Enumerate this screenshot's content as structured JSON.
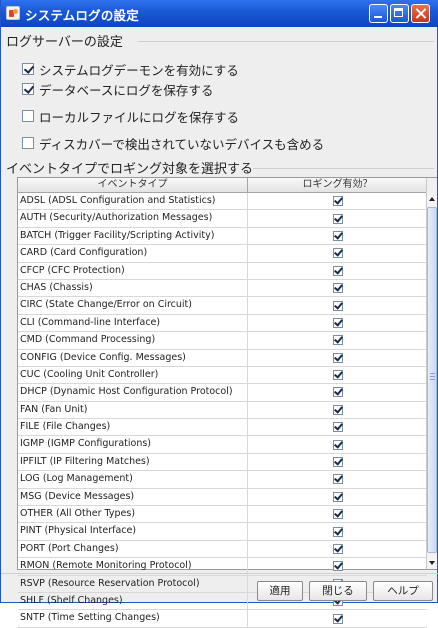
{
  "window": {
    "title": "システムログの設定"
  },
  "log_server_section": {
    "title": "ログサーバーの設定",
    "options": [
      {
        "label": "システムログデーモンを有効にする",
        "checked": true
      },
      {
        "label": "データベースにログを保存する",
        "checked": true
      },
      {
        "label": "ローカルファイルにログを保存する",
        "checked": false
      },
      {
        "label": "ディスカバーで検出されていないデバイスも含める",
        "checked": false
      }
    ]
  },
  "event_section": {
    "title": "イベントタイプでロギング対象を選択する",
    "columns": [
      "イベントタイプ",
      "ロギング有効？"
    ],
    "rows": [
      {
        "type": "ADSL (ADSL Configuration and Statistics)",
        "enabled": true
      },
      {
        "type": "AUTH (Security/Authorization Messages)",
        "enabled": true
      },
      {
        "type": "BATCH (Trigger Facility/Scripting Activity)",
        "enabled": true
      },
      {
        "type": "CARD (Card Configuration)",
        "enabled": true
      },
      {
        "type": "CFCP (CFC Protection)",
        "enabled": true
      },
      {
        "type": "CHAS (Chassis)",
        "enabled": true
      },
      {
        "type": "CIRC (State Change/Error on Circuit)",
        "enabled": true
      },
      {
        "type": "CLI (Command-line Interface)",
        "enabled": true
      },
      {
        "type": "CMD (Command Processing)",
        "enabled": true
      },
      {
        "type": "CONFIG (Device Config. Messages)",
        "enabled": true
      },
      {
        "type": "CUC (Cooling Unit Controller)",
        "enabled": true
      },
      {
        "type": "DHCP (Dynamic Host Configuration Protocol)",
        "enabled": true
      },
      {
        "type": "FAN (Fan Unit)",
        "enabled": true
      },
      {
        "type": "FILE (File Changes)",
        "enabled": true
      },
      {
        "type": "IGMP (IGMP Configurations)",
        "enabled": true
      },
      {
        "type": "IPFILT (IP Filtering Matches)",
        "enabled": true
      },
      {
        "type": "LOG (Log Management)",
        "enabled": true
      },
      {
        "type": "MSG (Device Messages)",
        "enabled": true
      },
      {
        "type": "OTHER (All Other Types)",
        "enabled": true
      },
      {
        "type": "PINT (Physical Interface)",
        "enabled": true
      },
      {
        "type": "PORT (Port Changes)",
        "enabled": true
      },
      {
        "type": "RMON (Remote Monitoring Protocol)",
        "enabled": true
      },
      {
        "type": "RSVP (Resource Reservation Protocol)",
        "enabled": true
      },
      {
        "type": "SHLF (Shelf Changes)",
        "enabled": true
      },
      {
        "type": "SNTP (Time Setting Changes)",
        "enabled": true
      }
    ]
  },
  "buttons": {
    "apply": "適用",
    "close": "閉じる",
    "help": "ヘルプ"
  },
  "colors": {
    "titlebar": "#1b5ad6",
    "close_button": "#c4381b"
  }
}
